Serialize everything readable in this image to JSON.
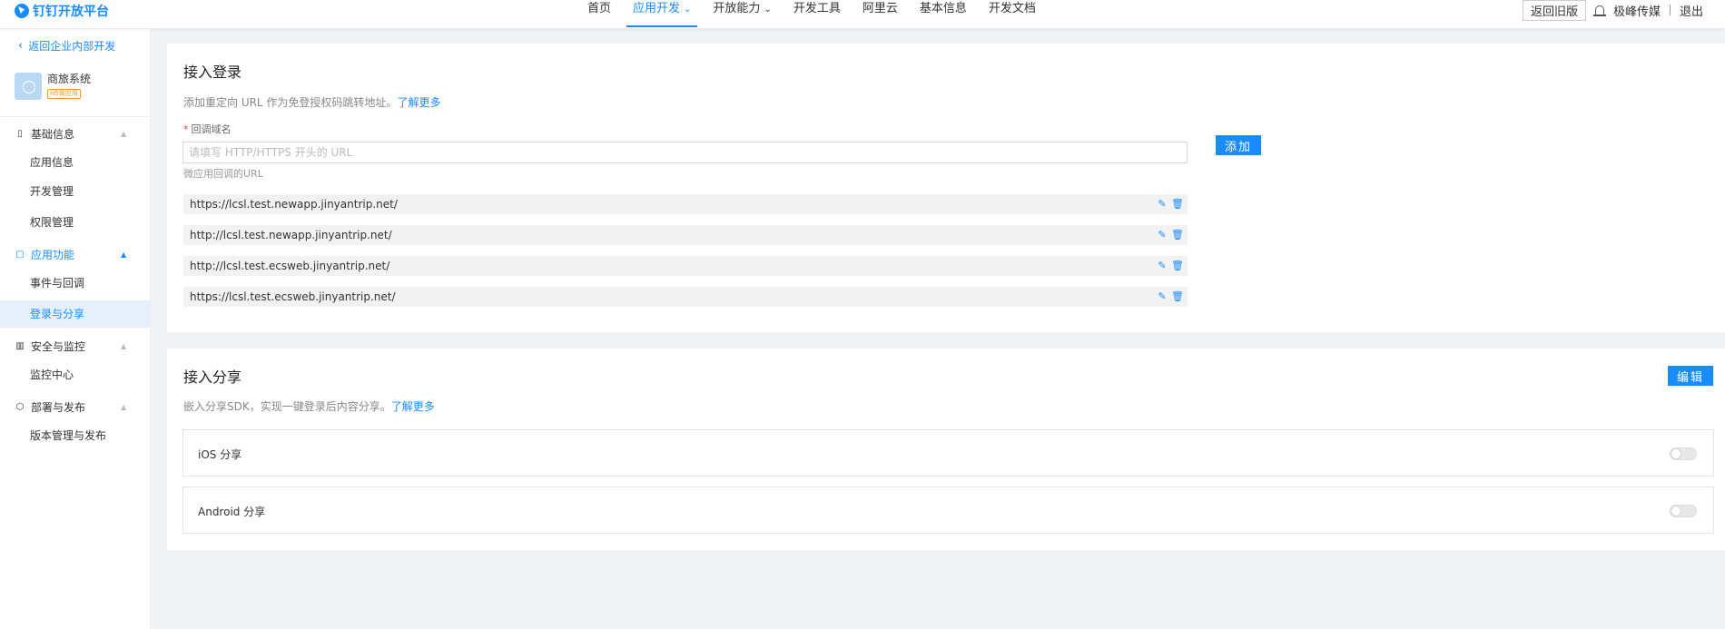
{
  "header": {
    "brand": "钉钉开放平台",
    "nav": [
      {
        "label": "首页",
        "active": false,
        "dropdown": false
      },
      {
        "label": "应用开发",
        "active": true,
        "dropdown": true
      },
      {
        "label": "开放能力",
        "active": false,
        "dropdown": true
      },
      {
        "label": "开发工具",
        "active": false,
        "dropdown": false
      },
      {
        "label": "阿里云",
        "active": false,
        "dropdown": false
      },
      {
        "label": "基本信息",
        "active": false,
        "dropdown": false
      },
      {
        "label": "开发文档",
        "active": false,
        "dropdown": false
      }
    ],
    "old_version": "返回旧版",
    "org": "极峰传媒",
    "logout": "退出"
  },
  "sidebar": {
    "back": "返回企业内部开发",
    "app_name": "商旅系统",
    "app_tag": "H5微应用",
    "groups": [
      {
        "label": "基础信息",
        "icon": "document-icon",
        "items": [
          "应用信息",
          "开发管理",
          "权限管理"
        ]
      },
      {
        "label": "应用功能",
        "icon": "app-icon",
        "items": [
          "事件与回调",
          "登录与分享"
        ]
      },
      {
        "label": "安全与监控",
        "icon": "chart-icon",
        "items": [
          "监控中心"
        ]
      },
      {
        "label": "部署与发布",
        "icon": "cube-icon",
        "items": [
          "版本管理与发布"
        ]
      }
    ],
    "active_item": "登录与分享"
  },
  "login": {
    "title": "接入登录",
    "desc": "添加重定向 URL 作为免登授权码跳转地址。",
    "more": "了解更多",
    "field_label": "回调域名",
    "placeholder": "请填写 HTTP/HTTPS 开头的 URL",
    "add_button": "添加",
    "hint": "微应用回调的URL",
    "urls": [
      "https://lcsl.test.newapp.jinyantrip.net/",
      "http://lcsl.test.newapp.jinyantrip.net/",
      "http://lcsl.test.ecsweb.jinyantrip.net/",
      "https://lcsl.test.ecsweb.jinyantrip.net/"
    ]
  },
  "share": {
    "title": "接入分享",
    "edit_button": "编辑",
    "desc": "嵌入分享SDK，实现一键登录后内容分享。",
    "more": "了解更多",
    "rows": [
      {
        "label": "iOS 分享",
        "enabled": false
      },
      {
        "label": "Android 分享",
        "enabled": false
      }
    ]
  }
}
